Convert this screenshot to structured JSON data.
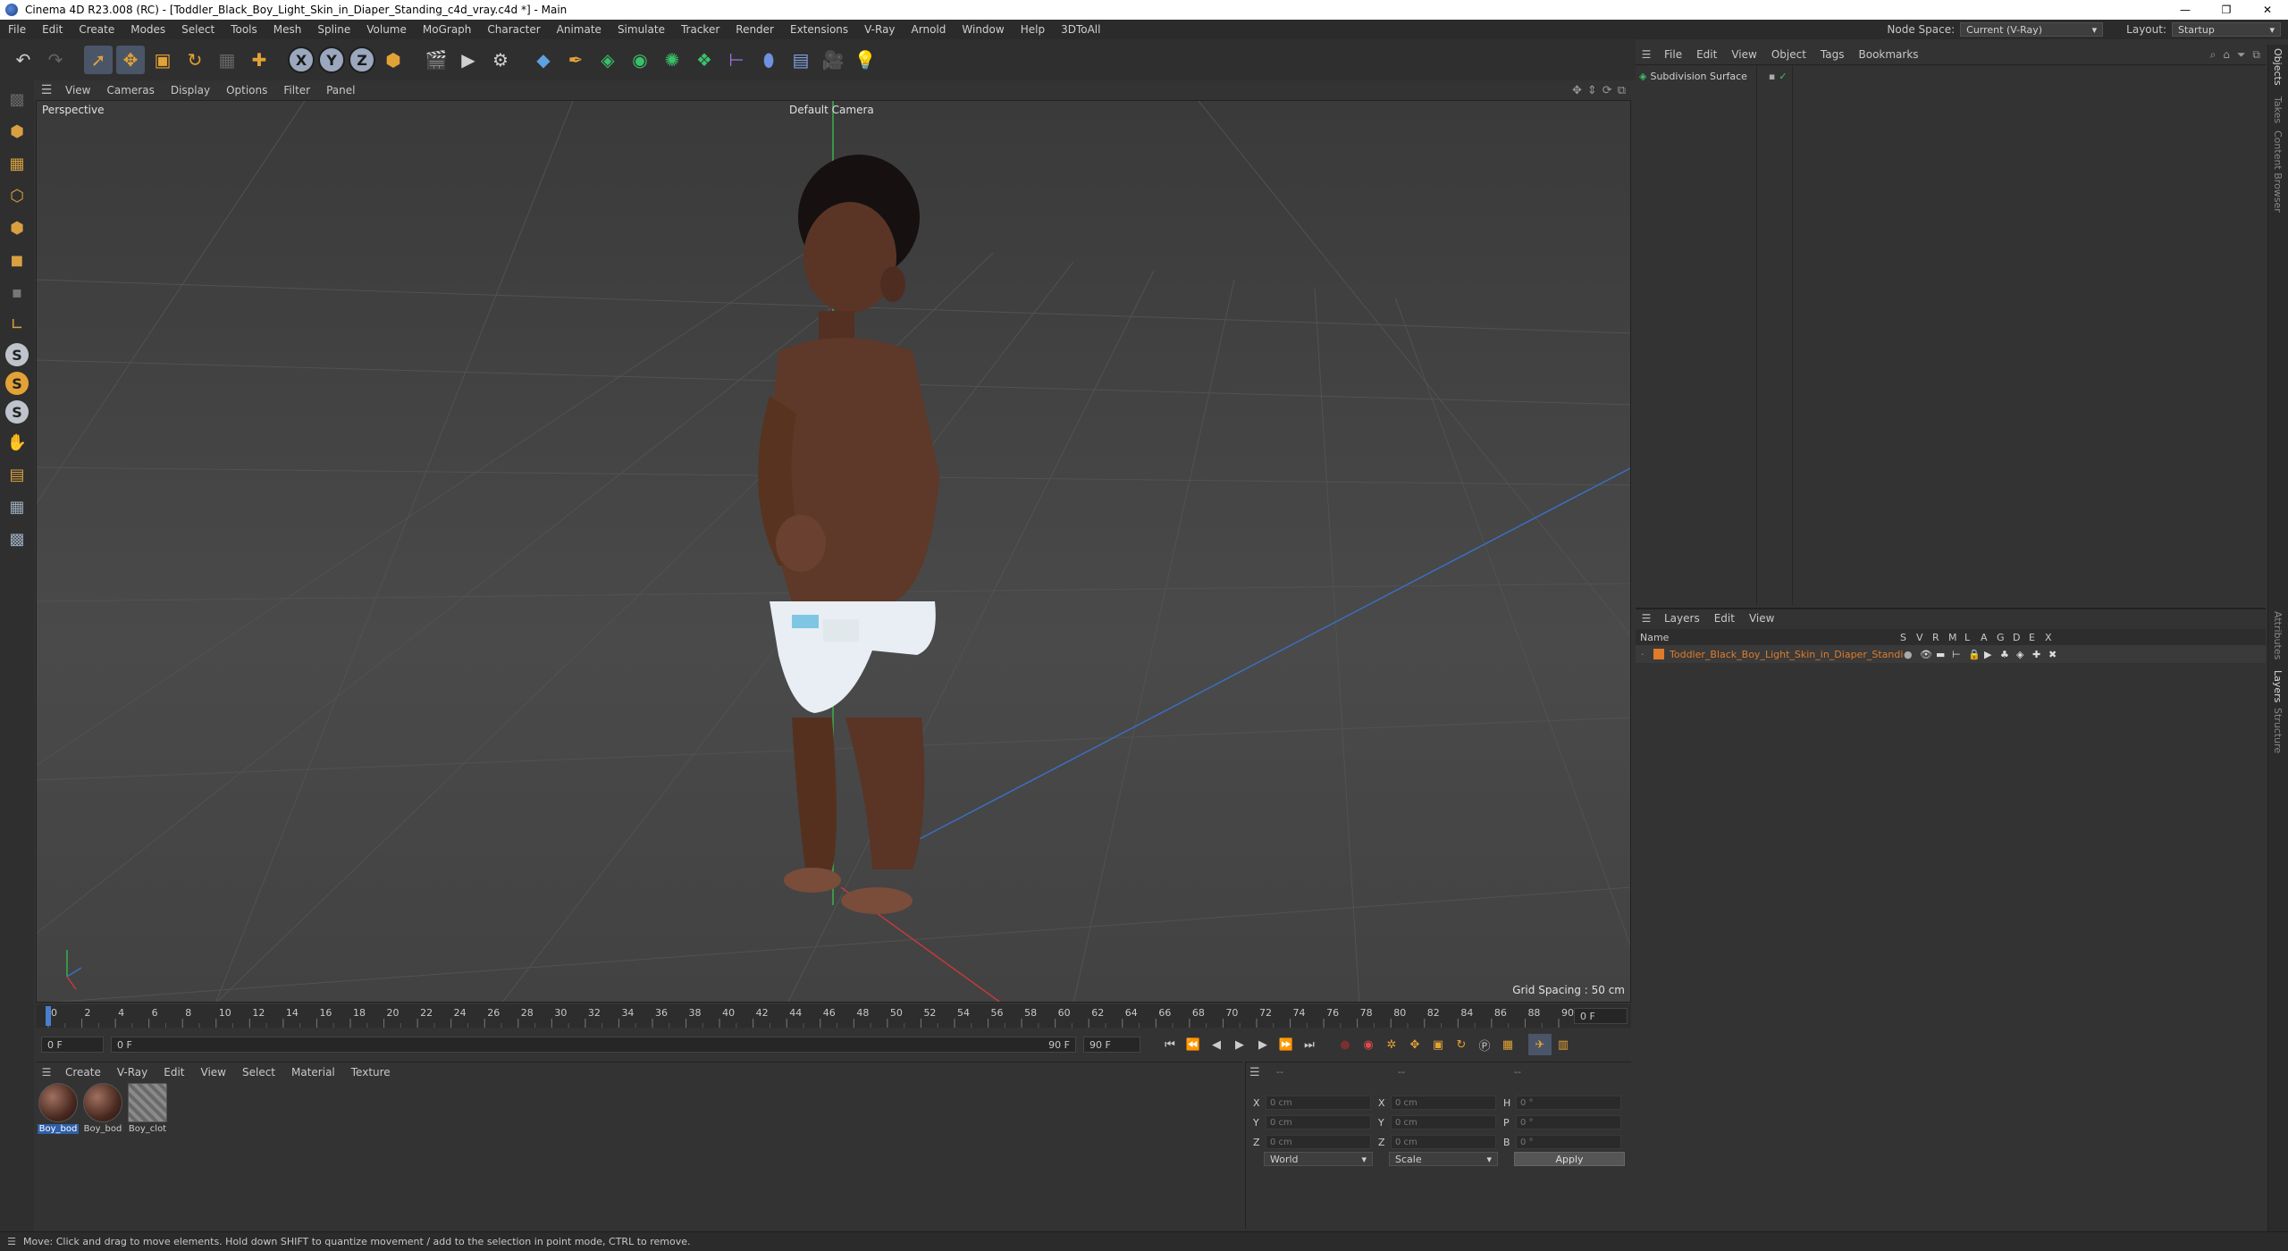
{
  "window": {
    "title": "Cinema 4D R23.008 (RC) - [Toddler_Black_Boy_Light_Skin_in_Diaper_Standing_c4d_vray.c4d *] - Main",
    "controls": [
      "—",
      "❐",
      "✕"
    ]
  },
  "menubar": {
    "items": [
      "File",
      "Edit",
      "Create",
      "Modes",
      "Select",
      "Tools",
      "Mesh",
      "Spline",
      "Volume",
      "MoGraph",
      "Character",
      "Animate",
      "Simulate",
      "Tracker",
      "Render",
      "Extensions",
      "V-Ray",
      "Arnold",
      "Window",
      "Help",
      "3DToAll"
    ],
    "node_space_label": "Node Space:",
    "node_space_value": "Current (V-Ray)",
    "layout_label": "Layout:",
    "layout_value": "Startup"
  },
  "viewport": {
    "menu": [
      "View",
      "Cameras",
      "Display",
      "Options",
      "Filter",
      "Panel"
    ],
    "view_name": "Perspective",
    "camera": "Default Camera",
    "grid_spacing": "Grid Spacing : 50 cm",
    "axis_labels": [
      "Y",
      "Z",
      "X"
    ]
  },
  "timeline": {
    "ticks": [
      "0",
      "2",
      "4",
      "6",
      "8",
      "10",
      "12",
      "14",
      "16",
      "18",
      "20",
      "22",
      "24",
      "26",
      "28",
      "30",
      "32",
      "34",
      "36",
      "38",
      "40",
      "42",
      "44",
      "46",
      "48",
      "50",
      "52",
      "54",
      "56",
      "58",
      "60",
      "62",
      "64",
      "66",
      "68",
      "70",
      "72",
      "74",
      "76",
      "78",
      "80",
      "82",
      "84",
      "86",
      "88",
      "90"
    ],
    "current_frame": "0 F",
    "start_field": "0 F",
    "range_start": "0 F",
    "range_end": "90 F",
    "end_field": "90 F"
  },
  "materials": {
    "menu": [
      "Create",
      "V-Ray",
      "Edit",
      "View",
      "Select",
      "Material",
      "Texture"
    ],
    "items": [
      "Boy_bod",
      "Boy_bod",
      "Boy_clot"
    ]
  },
  "coordinates": {
    "header": [
      "--",
      "--",
      "--"
    ],
    "position": [
      {
        "axis": "X",
        "value": "0 cm"
      },
      {
        "axis": "Y",
        "value": "0 cm"
      },
      {
        "axis": "Z",
        "value": "0 cm"
      }
    ],
    "size": [
      {
        "axis": "X",
        "value": "0 cm"
      },
      {
        "axis": "Y",
        "value": "0 cm"
      },
      {
        "axis": "Z",
        "value": "0 cm"
      }
    ],
    "rotation": [
      {
        "axis": "H",
        "value": "0 °"
      },
      {
        "axis": "P",
        "value": "0 °"
      },
      {
        "axis": "B",
        "value": "0 °"
      }
    ],
    "mode_dropdown": "World",
    "scale_dropdown": "Scale",
    "apply": "Apply"
  },
  "objects": {
    "menu": [
      "File",
      "Edit",
      "View",
      "Object",
      "Tags",
      "Bookmarks"
    ],
    "items": [
      {
        "name": "Subdivision Surface"
      }
    ]
  },
  "layers": {
    "menu": [
      "Layers",
      "Edit",
      "View"
    ],
    "columns": [
      "Name",
      "S",
      "V",
      "R",
      "M",
      "L",
      "A",
      "G",
      "D",
      "E",
      "X"
    ],
    "items": [
      {
        "name": "Toddler_Black_Boy_Light_Skin_in_Diaper_Standing",
        "color": "#e07b2a"
      }
    ]
  },
  "right_tabs": [
    "Objects",
    "Takes",
    "Content Browser",
    "Attributes",
    "Layers",
    "Structure"
  ],
  "status": "Move: Click and drag to move elements. Hold down SHIFT to quantize movement / add to the selection in point mode, CTRL to remove.",
  "colors": {
    "accent": "#4a7fd0",
    "layer_orange": "#e07b2a",
    "axis_x": "#c23b3b",
    "axis_y": "#3bb04a",
    "axis_z": "#3b6fc2"
  }
}
